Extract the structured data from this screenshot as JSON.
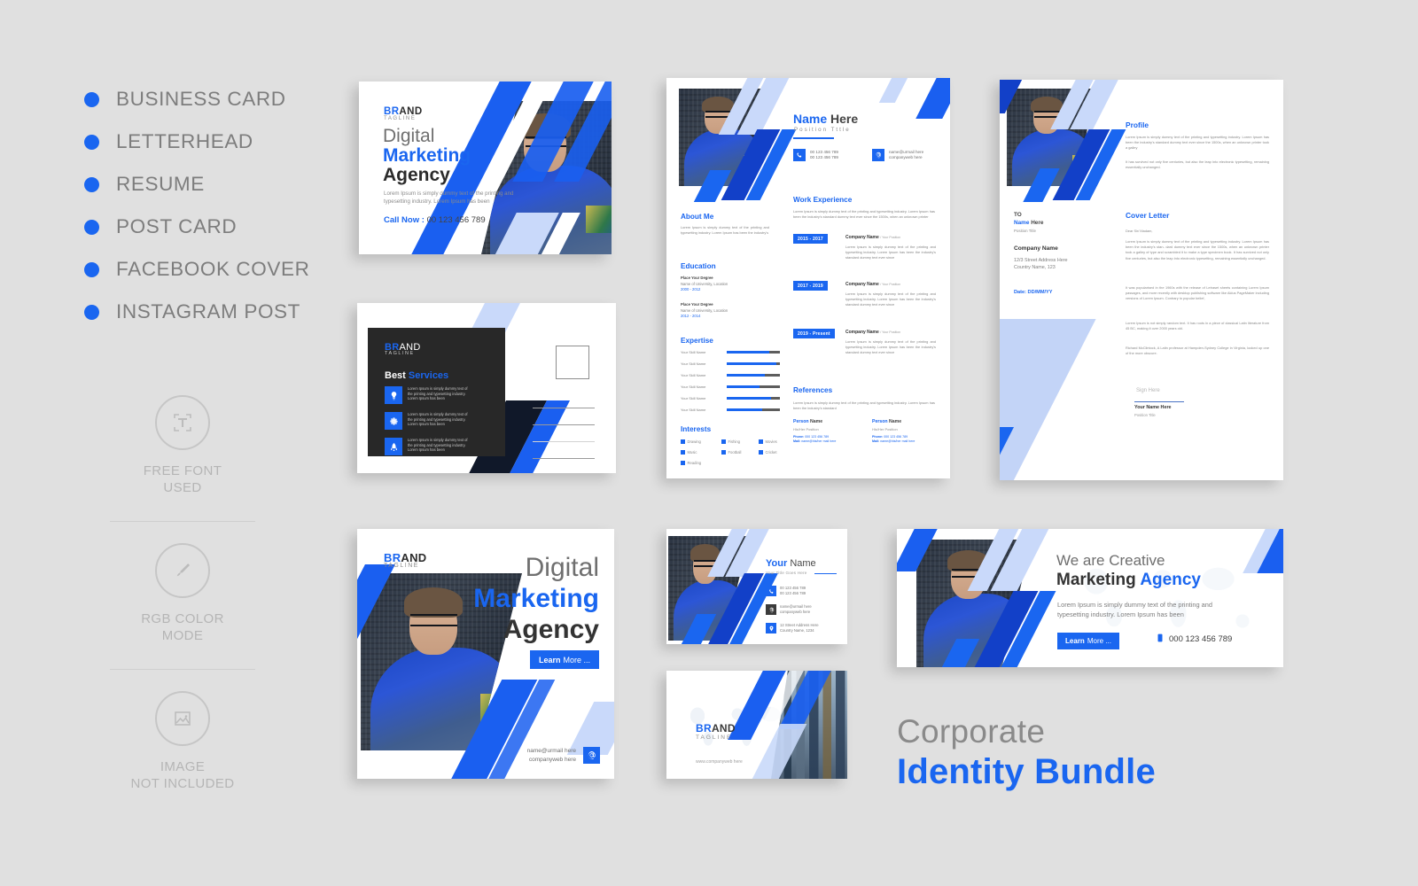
{
  "features": [
    {
      "label": "BUSINESS CARD"
    },
    {
      "label": "LETTERHEAD"
    },
    {
      "label": "RESUME"
    },
    {
      "label": "POST CARD"
    },
    {
      "label": "FACEBOOK COVER"
    },
    {
      "label": "INSTAGRAM POST"
    }
  ],
  "badges": [
    {
      "icon": "font-icon",
      "line1": "FREE FONT",
      "line2": "USED"
    },
    {
      "icon": "brush-icon",
      "line1": "RGB COLOR",
      "line2": "MODE"
    },
    {
      "icon": "image-icon",
      "line1": "IMAGE",
      "line2": "NOT INCLUDED"
    }
  ],
  "colors": {
    "accent_blue": "#1a66f0",
    "deep_blue": "#1240c8",
    "light_blue": "#c3d4f7",
    "dark_panel": "#282828",
    "page_bg": "#e0e0e0",
    "gray_text": "#7d7d7d"
  },
  "business_card_large": {
    "brand_bold": "BR",
    "brand_rest": "AND",
    "tagline": "TAGLINE",
    "headline_1": "Digital",
    "headline_2": "Marketing",
    "headline_3": "Agency",
    "body": "Lorem Ipsum is simply dummy text of the printing and typesetting industry. Lorem Ipsum has been",
    "call_label": "Call Now :",
    "call_number": "00 123 456 789"
  },
  "post_card": {
    "brand_bold": "BR",
    "brand_rest": "AND",
    "tagline": "TAGLINE",
    "title_dark": "Best",
    "title_blue": "Services",
    "services": [
      {
        "icon": "lightbulb-icon",
        "text": "Lorem Ipsum is simply dummy text of the printing and typesetting industry. Lorem Ipsum has been"
      },
      {
        "icon": "gear-icon",
        "text": "Lorem Ipsum is simply dummy text of the printing and typesetting industry. Lorem Ipsum has been"
      },
      {
        "icon": "rocket-icon",
        "text": "Lorem Ipsum is simply dummy text of the printing and typesetting industry. Lorem Ipsum has been"
      }
    ],
    "stamp_label": "stamp-box",
    "address_lines": 4
  },
  "resume": {
    "name_first": "Name",
    "name_last": "Here",
    "position": "Position Tttle",
    "contacts": [
      {
        "icon": "phone-icon",
        "line1": "00 123 456 789",
        "line2": "00 123 456 789"
      },
      {
        "icon": "at-icon",
        "line1": "name@urmail here",
        "line2": "companyweb here"
      }
    ],
    "about_title": "About Me",
    "about_text": "Lorem Ipsum is simply dummy text of the printing and typesetting industry. Lorem Ipsum has been the industry's",
    "education_title": "Education",
    "education": [
      {
        "degree": "Place Your Degree",
        "school": "Name of University, Location",
        "years": "2000 - 2012"
      },
      {
        "degree": "Place Your Degree",
        "school": "Name of University, Location",
        "years": "2012 - 2014"
      }
    ],
    "expertise_title": "Expertise",
    "skills": [
      {
        "name": "Your Skill Name",
        "value": 80
      },
      {
        "name": "Your Skill Name",
        "value": 93
      },
      {
        "name": "Your Skill Name",
        "value": 72
      },
      {
        "name": "Your Skill Name",
        "value": 62
      },
      {
        "name": "Your Skill Name",
        "value": 84
      },
      {
        "name": "Your Skill Name",
        "value": 66
      }
    ],
    "interests_title": "Interests",
    "interests": [
      "Drawing",
      "Fishing",
      "Movies",
      "Music",
      "Football",
      "Cricket",
      "Reading"
    ],
    "work_title": "Work Experience",
    "work_intro": "Lorem Ipsum is simply dummy text of the printing and typesetting industry. Lorem Ipsum has been the industry's standard dummy text ever since the 1500s, when an unknown printer",
    "jobs": [
      {
        "period": "2015 - 2017",
        "company": "Company Name",
        "role": "/ Your Position",
        "text": "Lorem Ipsum is simply dummy text of the printing and typesetting industry. Lorem Ipsum has been the industry's standard dummy text ever since"
      },
      {
        "period": "2017 - 2019",
        "company": "Company Name",
        "role": "/ Your Position",
        "text": "Lorem Ipsum is simply dummy text of the printing and typesetting industry. Lorem Ipsum has been the industry's standard dummy text ever since"
      },
      {
        "period": "2019 - Present",
        "company": "Company Name",
        "role": "/ Your Position",
        "text": "Lorem Ipsum is simply dummy text of the printing and typesetting industry. Lorem Ipsum has been the industry's standard dummy text ever since"
      }
    ],
    "references_title": "References",
    "references_intro": "Lorem Ipsum is simply dummy text of the printing and typesetting industry. Lorem Ipsum has been the industry's standard",
    "references": [
      {
        "first": "Person",
        "last": "Name",
        "position": "His/Her Position",
        "phone_label": "Phone:",
        "phone": "000 123 456 789",
        "mail_label": "Mail:",
        "mail": "name@his/her mail here"
      },
      {
        "first": "Person",
        "last": "Name",
        "position": "His/Her Position",
        "phone_label": "Phone:",
        "phone": "000 123 456 789",
        "mail_label": "Mail:",
        "mail": "name@his/her mail here"
      }
    ]
  },
  "letterhead": {
    "profile_title": "Profile",
    "profile_p1": "Lorem Ipsum is simply dummy text of the printing and typesetting industry. Lorem Ipsum has been the industry's standard dummy text ever since the 1500s, when an unknown printer took a galley",
    "profile_p2": "It has survived not only five centuries, but also the leap into electronic typesetting, remaining essentially unchanged.",
    "to_label": "TO",
    "to_name_first": "Name",
    "to_name_last": "Here",
    "to_position": "Position Title",
    "company": "Company Name",
    "address_1": "12/3 Street Address Here",
    "address_2": "Country Name, 123",
    "date": "Date: DD/MM/YY",
    "cover_title": "Cover Letter",
    "salutation": "Dear Sir/ Madam,",
    "cover_p1": "Lorem Ipsum is simply dummy text of the printing and typesetting industry. Lorem Ipsum has been the industry's stan- dard dummy text ever since the 1500s, when an unknown printer took a galley of type and scrambled it to make a type specimen book. It has survived not only five centuries, but also the leap into electronic typesetting, remaining essentially unchanged.",
    "cover_p2": "It was popularised in the 1960s with the release of Letraset sheets containing Lorem Ipsum passages, and more recently with desktop publishing software like Aldus PageMaker including versions of Lorem Ipsum. Contrary to popular belief,",
    "cover_p3": "Lorem Ipsum is not simply random text. It has roots in a piece of classical Latin literature from 45 BC, making it over 2000 years old.",
    "cover_p4": "Richard McClintock, A Latin professor at Hampden-Sydney College in Virginia, looked up one of the more obscure.",
    "sign_here": "Sign Here",
    "sign_name": "Your Name Here",
    "sign_position": "Position Title"
  },
  "instagram": {
    "brand_bold": "BR",
    "brand_rest": "AND",
    "tagline": "TAGLINE",
    "headline_1": "Digital",
    "headline_2": "Marketing",
    "headline_3": "Agency",
    "button_bold": "Learn",
    "button_rest": "More ...",
    "mail": "name@urmail here",
    "web": "companyweb here",
    "at_icon": "at-icon"
  },
  "business_card_small": {
    "name_bold": "Your",
    "name_rest": "Name",
    "subtitle": "Your Title Goes Here",
    "rows": [
      {
        "icon": "phone-icon",
        "line1": "00 123 456 789",
        "line2": "00 123 456 789"
      },
      {
        "icon": "at-icon",
        "line1": "name@urmail here",
        "line2": "companyweb here"
      },
      {
        "icon": "pin-icon",
        "line1": "12 Street Address Here",
        "line2": "Country Name, 1234"
      }
    ]
  },
  "business_card_back": {
    "brand_bold": "BR",
    "brand_rest": "AND",
    "tagline": "TAGLINE",
    "website": "www.companyweb here"
  },
  "facebook_cover": {
    "headline_1": "We are Creative",
    "headline_2a": "Marketing",
    "headline_2b": "Agency",
    "body": "Lorem Ipsum is simply dummy text of the printing and typesetting industry. Lorem Ipsum has been",
    "button_bold": "Learn",
    "button_rest": "More ...",
    "phone_icon": "phone-icon",
    "phone": "000 123 456 789"
  },
  "main_title": {
    "line1": "Corporate",
    "line2": "Identity Bundle"
  }
}
